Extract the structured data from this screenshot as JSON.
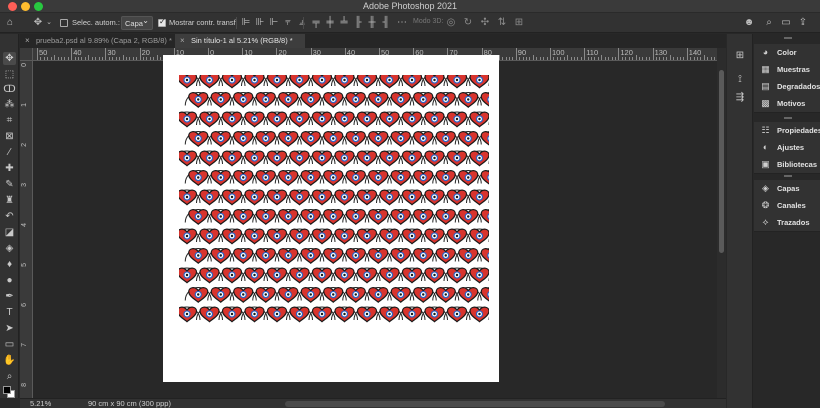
{
  "app": {
    "title": "Adobe Photoshop 2021"
  },
  "options_bar": {
    "auto_select_label": "Selec. autom.:",
    "auto_select_target": "Capa",
    "show_transform_label": "Mostrar contr. transf.",
    "mode3d_label": "Modo 3D:"
  },
  "tabs": [
    {
      "label": "prueba2.psd al 9.89% (Capa 2, RGB/8) *",
      "close": "×"
    },
    {
      "label": "Sin título-1 al 5.21% (RGB/8) *",
      "close": "×"
    }
  ],
  "ruler": {
    "top_labels": [
      "50",
      "40",
      "30",
      "20",
      "10",
      "0",
      "10",
      "20",
      "30",
      "40",
      "50",
      "60",
      "70",
      "80",
      "90",
      "100",
      "110",
      "120",
      "130",
      "140"
    ],
    "left_labels": [
      "0",
      "1",
      "2",
      "3",
      "4",
      "5",
      "6",
      "7",
      "8"
    ]
  },
  "status": {
    "zoom": "5.21%",
    "doc_info": "90 cm x 90 cm (300 ppp)"
  },
  "panels": {
    "group1": [
      {
        "icon": "color-wheel-icon",
        "label": "Color"
      },
      {
        "icon": "swatches-icon",
        "label": "Muestras"
      },
      {
        "icon": "gradient-icon",
        "label": "Degradados"
      },
      {
        "icon": "patterns-icon",
        "label": "Motivos"
      }
    ],
    "group2": [
      {
        "icon": "properties-icon",
        "label": "Propiedades"
      },
      {
        "icon": "adjustments-icon",
        "label": "Ajustes"
      },
      {
        "icon": "libraries-icon",
        "label": "Bibliotecas"
      }
    ],
    "group3": [
      {
        "icon": "layers-icon",
        "label": "Capas"
      },
      {
        "icon": "channels-icon",
        "label": "Canales"
      },
      {
        "icon": "paths-icon",
        "label": "Trazados"
      }
    ]
  },
  "colors": {
    "heart_fill": "#d8342e",
    "heart_stroke": "#1a1a1a",
    "eye_blue": "#2a64c8",
    "traffic_red": "#fe5f57",
    "traffic_yellow": "#febc2e",
    "traffic_green": "#28c840"
  }
}
